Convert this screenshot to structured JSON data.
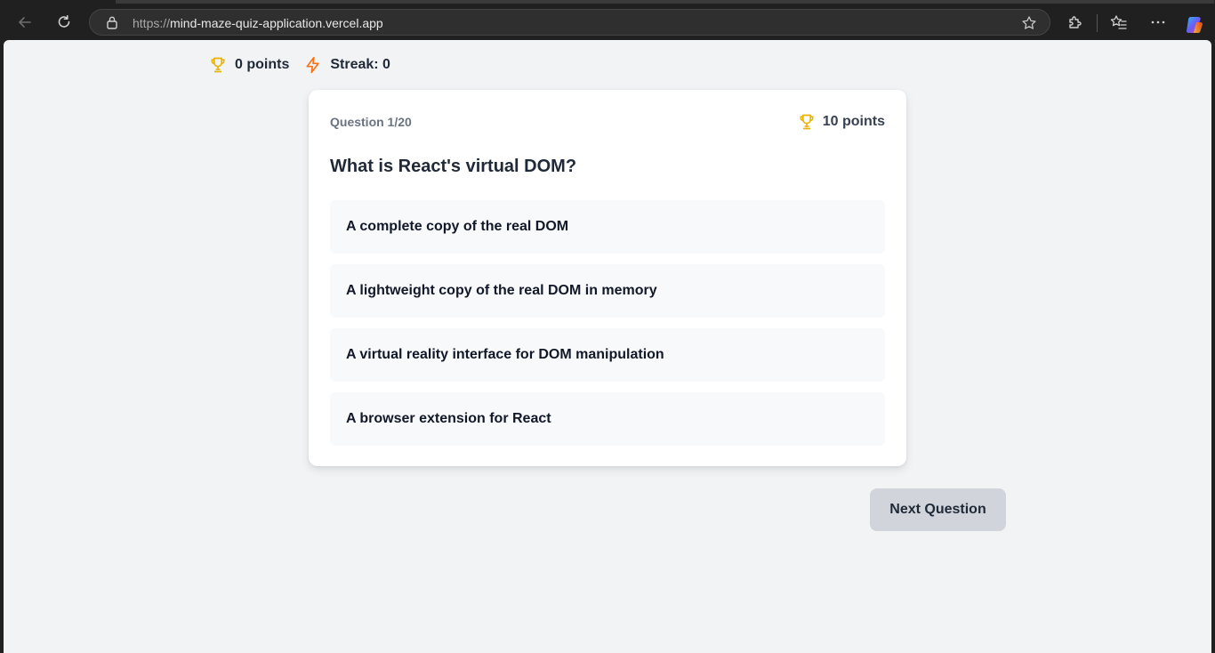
{
  "browser": {
    "url_scheme": "https://",
    "url_host": "mind-maze-quiz-application.vercel.app"
  },
  "stats": {
    "points_label": "0 points",
    "streak_label": "Streak: 0"
  },
  "quiz": {
    "progress_label": "Question 1/20",
    "question_points_label": "10 points",
    "question": "What is React's virtual DOM?",
    "options": [
      "A complete copy of the real DOM",
      "A lightweight copy of the real DOM in memory",
      "A virtual reality interface for DOM manipulation",
      "A browser extension for React"
    ],
    "next_label": "Next Question"
  },
  "icons": {
    "trophy": "trophy-icon",
    "streak": "lightning-icon"
  },
  "colors": {
    "trophy": "#eab308",
    "streak": "#f97316",
    "next_button_bg": "#d1d5db",
    "page_bg": "#f2f3f5"
  }
}
